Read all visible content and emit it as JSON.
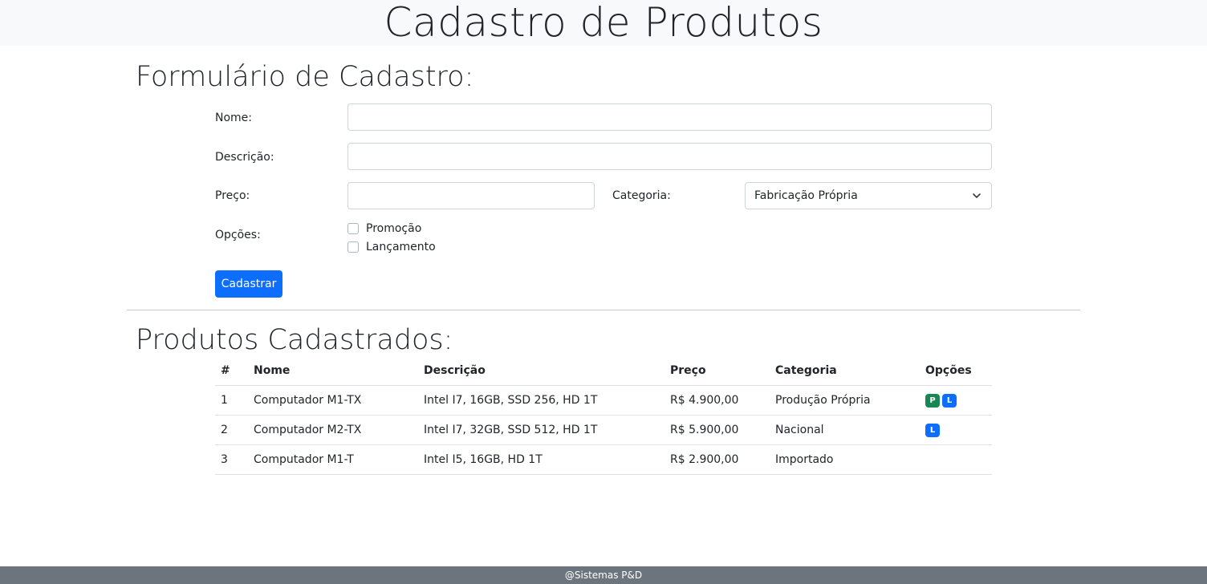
{
  "header": {
    "title": "Cadastro de Produtos"
  },
  "form": {
    "title": "Formulário de Cadastro:",
    "nome_label": "Nome:",
    "nome_value": "",
    "descricao_label": "Descrição:",
    "descricao_value": "",
    "preco_label": "Preço:",
    "preco_value": "",
    "categoria_label": "Categoria:",
    "categoria_selected": "Fabricação Própria",
    "opcoes_label": "Opções:",
    "opcao_promocao": "Promoção",
    "opcao_lancamento": "Lançamento",
    "submit_label": "Cadastrar"
  },
  "list": {
    "title": "Produtos Cadastrados:",
    "columns": [
      "#",
      "Nome",
      "Descrição",
      "Preço",
      "Categoria",
      "Opções"
    ],
    "rows": [
      {
        "id": "1",
        "nome": "Computador M1-TX",
        "descricao": "Intel I7, 16GB, SSD 256, HD 1T",
        "preco": "R$ 4.900,00",
        "categoria": "Produção Própria",
        "badges": [
          "P",
          "L"
        ]
      },
      {
        "id": "2",
        "nome": "Computador M2-TX",
        "descricao": "Intel I7, 32GB, SSD 512, HD 1T",
        "preco": "R$ 5.900,00",
        "categoria": "Nacional",
        "badges": [
          "L"
        ]
      },
      {
        "id": "3",
        "nome": "Computador M1-T",
        "descricao": "Intel I5, 16GB, HD 1T",
        "preco": "R$ 2.900,00",
        "categoria": "Importado",
        "badges": []
      }
    ]
  },
  "footer": {
    "text": "@Sistemas P&D"
  },
  "colors": {
    "primary": "#0d6efd",
    "success": "#198754",
    "footer_bg": "#6c757d",
    "header_bg": "#f8f9fa"
  }
}
